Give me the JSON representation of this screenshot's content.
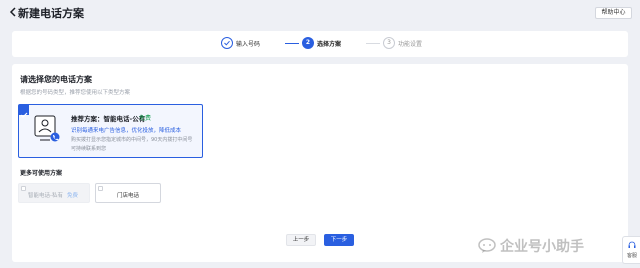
{
  "header": {
    "back_icon": "chevron-left-icon",
    "title": "新建电话方案",
    "help_label": "帮助中心"
  },
  "steps": [
    {
      "label": "输入号码",
      "state": "done",
      "number": ""
    },
    {
      "label": "选择方案",
      "state": "active",
      "number": "2"
    },
    {
      "label": "功能设置",
      "state": "pending",
      "number": "3"
    }
  ],
  "main": {
    "section_title": "请选择您的电话方案",
    "section_desc": "根据您的号码类型，推荐您使用以下类型方案",
    "recommended": {
      "selected": true,
      "title": "推荐方案：智能电话-公有",
      "badge": "免费",
      "feature": "识别每通来电广告信息，优化投放，降低成本",
      "desc_line1": "购买拨打显示您指定城市的中间号，90天内拨打中间号",
      "desc_line2": "可持续联系到您",
      "icon": "agent-phone-icon"
    },
    "more_title": "更多可使用方案",
    "options": [
      {
        "label": "智能电话-私有",
        "badge": "免费",
        "disabled": true
      },
      {
        "label": "门店电话",
        "badge": "",
        "disabled": false
      }
    ]
  },
  "footer": {
    "prev_label": "上一步",
    "next_label": "下一步"
  },
  "feedback": {
    "icon": "headset-icon",
    "label": "客服"
  },
  "watermark": {
    "text": "企业号小助手",
    "icon": "chat-bubble-icon"
  },
  "colors": {
    "primary": "#2a5fe0",
    "free_green": "#1aa055",
    "background": "#eef0f5"
  }
}
